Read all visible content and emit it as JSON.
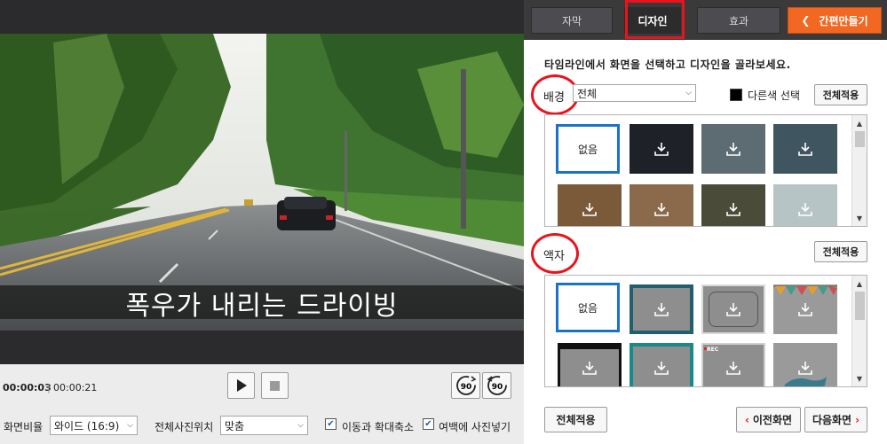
{
  "video": {
    "subtitle": "폭우가 내리는 드라이빙",
    "time_current": "00:00:03",
    "time_separator": "|",
    "time_total": "00:00:21",
    "rotate_cw_label": "90",
    "rotate_ccw_label": "90"
  },
  "options": {
    "aspect_label": "화면비율",
    "aspect_value": "와이드 (16:9)",
    "photo_position_label": "전체사진위치",
    "photo_position_value": "맞춤",
    "zoom_pan_label": "이동과 확대축소",
    "zoom_pan_checked": true,
    "fill_margin_label": "여백에 사진넣기",
    "fill_margin_checked": true
  },
  "tabs": {
    "subtitle": "자막",
    "design": "디자인",
    "effects": "효과",
    "quick_make": "간편만들기",
    "active": "design"
  },
  "design": {
    "instruction": "타임라인에서 화면을 선택하고 디자인을 골라보세요.",
    "background": {
      "label": "배경",
      "select_value": "전체",
      "other_color_label": "다른색 선택",
      "apply_all": "전체적용",
      "none_label": "없음",
      "thumbnails": [
        {
          "type": "none"
        },
        {
          "type": "download",
          "color": "#1e2228"
        },
        {
          "type": "download",
          "color": "#5d6b72"
        },
        {
          "type": "download",
          "color": "#3f5560"
        },
        {
          "type": "download",
          "color": "#7a5a38"
        },
        {
          "type": "download",
          "color": "#8a6a4a"
        },
        {
          "type": "download",
          "color": "#4b4b3a"
        },
        {
          "type": "download",
          "color": "#b7c4c6"
        }
      ]
    },
    "frame": {
      "label": "액자",
      "apply_all": "전체적용",
      "none_label": "없음",
      "rec_label": "REC",
      "thumbnails": [
        {
          "type": "none"
        },
        {
          "type": "download",
          "color": "#8e8e8e",
          "border": "#1f5f6e"
        },
        {
          "type": "download",
          "color": "#8e8e8e",
          "border": "#d9d9d9"
        },
        {
          "type": "download",
          "color": "#9a9a9a",
          "border": "#9a9a9a"
        },
        {
          "type": "download",
          "color": "#8e8e8e",
          "border": "#111111"
        },
        {
          "type": "download",
          "color": "#8e8e8e",
          "border": "#178a8a"
        },
        {
          "type": "download",
          "color": "#8e8e8e",
          "border": "#cfcfcf"
        },
        {
          "type": "download",
          "color": "#9a9a9a",
          "border": "#9a9a9a"
        }
      ]
    }
  },
  "footer": {
    "apply_all": "전체적용",
    "prev": "이전화면",
    "next": "다음화면"
  },
  "colors": {
    "accent_orange": "#f26722",
    "highlight_red": "#e8141c",
    "selection_blue": "#1b73c8"
  }
}
